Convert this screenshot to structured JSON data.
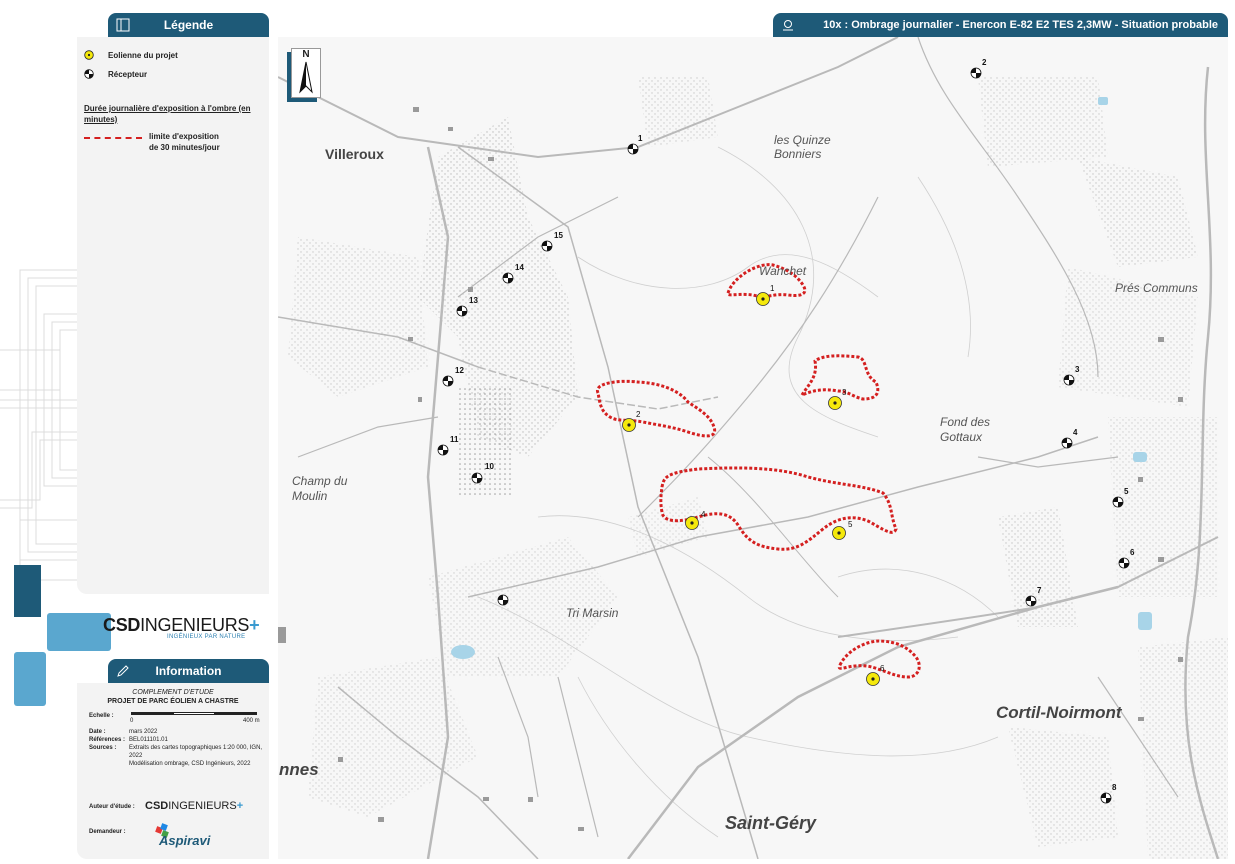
{
  "legend": {
    "title": "Légende",
    "turbine_label": "Eolienne du projet",
    "receptor_label": "Récepteur",
    "duration_title": "Durée journalière d'exposition à l'ombre (en minutes)",
    "limit_label_1": "limite d'exposition",
    "limit_label_2": "de 30 minutes/jour"
  },
  "map_header": "10x : Ombrage journalier - Enercon E-82 E2 TES 2,3MW - Situation probable",
  "north_label": "N",
  "places": {
    "villeroux": "Villeroux",
    "quinze_1": "les Quinze",
    "quinze_2": "Bonniers",
    "wanchet": "Wanchet",
    "pres_communs": "Prés Communs",
    "fond_1": "Fond des",
    "fond_2": "Gottaux",
    "champ_1": "Champ du",
    "champ_2": "Moulin",
    "tri_marsin": "Tri Marsin",
    "cortil": "Cortil-Noirmont",
    "saint_gery": "Saint-Géry",
    "nnes": "nnes"
  },
  "turbines": [
    "1",
    "2",
    "3",
    "4",
    "5",
    "6"
  ],
  "receptors": [
    "1",
    "2",
    "3",
    "4",
    "5",
    "6",
    "7",
    "8",
    "10",
    "11",
    "12",
    "13",
    "14",
    "15"
  ],
  "company": {
    "name_bold": "CSD",
    "name_thin": "INGENIEURS",
    "plus": "+",
    "tagline": "INGÉNIEUX PAR NATURE"
  },
  "info": {
    "title": "Information",
    "study_type": "COMPLEMENT D'ETUDE",
    "project": "PROJET DE PARC ÉOLIEN A CHASTRE",
    "scale_label": "Echelle :",
    "scale_min": "0",
    "scale_max": "400  m",
    "date_label": "Date :",
    "date": "mars 2022",
    "ref_label": "Références :",
    "ref": "BEL011101.01",
    "sources_label": "Sources :",
    "sources_1": "Extraits des cartes topographiques 1:20 000, IGN, 2022",
    "sources_2": "Modélisation ombrage, CSD Ingénieurs, 2022",
    "author_label": "Auteur d'étude :",
    "author_name_bold": "CSD",
    "author_name_thin": "INGENIEURS",
    "client_label": "Demandeur :",
    "client_name": "Aspiravi"
  },
  "colors": {
    "header": "#1e5a78",
    "limit": "#d42020",
    "turbine": "#f5e90c",
    "accent": "#3a9ad0"
  }
}
